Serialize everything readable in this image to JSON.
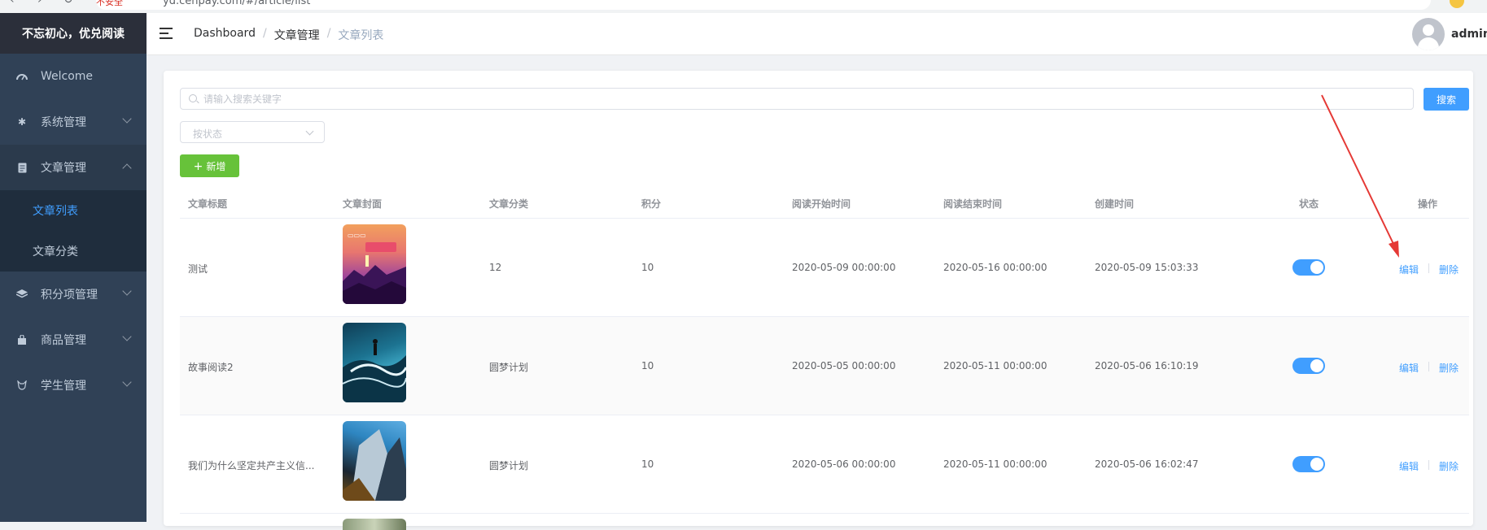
{
  "browser": {
    "security_label": "不安全",
    "url": "yd.cehpay.com/#/article/list"
  },
  "sidebar": {
    "brand": "不忘初心，优兑阅读",
    "items": [
      {
        "label": "Welcome",
        "icon": "dashboard-icon"
      },
      {
        "label": "系统管理",
        "icon": "gear-icon"
      },
      {
        "label": "文章管理",
        "icon": "document-icon",
        "open": true,
        "children": [
          {
            "label": "文章列表",
            "active": true
          },
          {
            "label": "文章分类",
            "active": false
          }
        ]
      },
      {
        "label": "积分项管理",
        "icon": "layers-icon"
      },
      {
        "label": "商品管理",
        "icon": "bag-icon"
      },
      {
        "label": "学生管理",
        "icon": "student-icon"
      }
    ]
  },
  "header": {
    "breadcrumb": [
      "Dashboard",
      "文章管理",
      "文章列表"
    ],
    "username": "admin"
  },
  "toolbar": {
    "search_placeholder": "请输入搜索关键字",
    "search_button": "搜索",
    "status_placeholder": "按状态",
    "add_button": "新增"
  },
  "table": {
    "columns": [
      "文章标题",
      "文章封面",
      "文章分类",
      "积分",
      "阅读开始时间",
      "阅读结束时间",
      "创建时间",
      "状态",
      "操作"
    ],
    "rows": [
      {
        "title": "测试",
        "category": "12",
        "points": "10",
        "start": "2020-05-09 00:00:00",
        "end": "2020-05-16 00:00:00",
        "created": "2020-05-09 15:03:33",
        "enabled": true
      },
      {
        "title": "故事阅读2",
        "category": "圆梦计划",
        "points": "10",
        "start": "2020-05-05 00:00:00",
        "end": "2020-05-11 00:00:00",
        "created": "2020-05-06 16:10:19",
        "enabled": true
      },
      {
        "title": "我们为什么坚定共产主义信...",
        "category": "圆梦计划",
        "points": "10",
        "start": "2020-05-06 00:00:00",
        "end": "2020-05-11 00:00:00",
        "created": "2020-05-06 16:02:47",
        "enabled": true
      }
    ],
    "edit_label": "编辑",
    "delete_label": "删除"
  },
  "colors": {
    "sidebar_bg": "#304156",
    "primary": "#409eff",
    "success": "#67c23a",
    "annotation": "#e53935"
  }
}
